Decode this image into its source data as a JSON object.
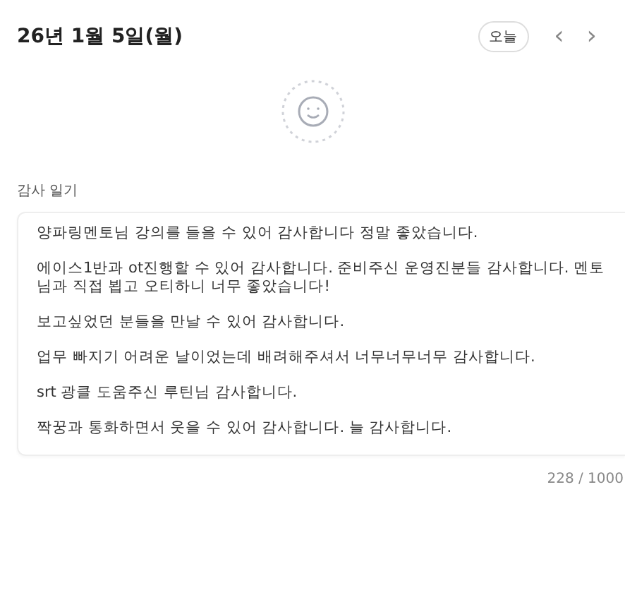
{
  "header": {
    "date": "26년 1월 5일(월)",
    "today_button": "오늘",
    "prev": "‹",
    "next": "›"
  },
  "mood": {
    "kind": "empty"
  },
  "diary": {
    "label": "감사 일기",
    "paragraphs": [
      "양파링멘토님 강의를 들을 수 있어 감사합니다 정말 좋았습니다.",
      "에이스1반과 ot진행할 수 있어 감사합니다. 준비주신 운영진분들 감사합니다. 멘토님과 직접 뵙고 오티하니 너무 좋았습니다!",
      "보고싶었던 분들을 만날 수 있어 감사합니다.",
      "업무 빠지기 어려운 날이었는데 배려해주셔서 너무너무너무 감사합니다.",
      "srt 광클 도움주신 루틴님 감사합니다.",
      "짝꿍과 통화하면서 웃을 수 있어 감사합니다. 늘 감사합니다."
    ],
    "counter": "228 / 1000"
  }
}
